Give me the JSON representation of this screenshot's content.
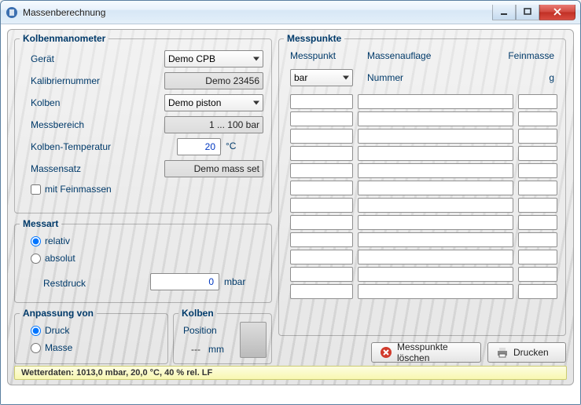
{
  "window": {
    "title": "Massenberechnung"
  },
  "kolbenmanometer": {
    "legend": "Kolbenmanometer",
    "geraet_label": "Gerät",
    "geraet_value": "Demo CPB",
    "kalibriernummer_label": "Kalibriernummer",
    "kalibriernummer_value": "Demo 23456",
    "kolben_label": "Kolben",
    "kolben_value": "Demo piston",
    "messbereich_label": "Messbereich",
    "messbereich_value": "1 ... 100 bar",
    "kolbentemp_label": "Kolben-Temperatur",
    "kolbentemp_value": "20",
    "kolbentemp_unit": "°C",
    "massensatz_label": "Massensatz",
    "massensatz_value": "Demo mass set",
    "feinmassen_label": "mit Feinmassen"
  },
  "messart": {
    "legend": "Messart",
    "relativ_label": "relativ",
    "absolut_label": "absolut",
    "restdruck_label": "Restdruck",
    "restdruck_value": "0",
    "restdruck_unit": "mbar"
  },
  "anpassung": {
    "legend": "Anpassung von",
    "druck_label": "Druck",
    "masse_label": "Masse"
  },
  "kolbenbox": {
    "legend": "Kolben",
    "position_label": "Position",
    "position_value": "---",
    "position_unit": "mm"
  },
  "messpunkte": {
    "legend": "Messpunkte",
    "col_messpunkt": "Messpunkt",
    "col_massenauflage": "Massenauflage",
    "col_feinmasse": "Feinmasse",
    "unit_select": "bar",
    "nummer_label": "Nummer",
    "feinmasse_unit": "g",
    "row_count": 12
  },
  "buttons": {
    "loeschen": "Messpunkte löschen",
    "drucken": "Drucken"
  },
  "status": "Wetterdaten: 1013,0 mbar, 20,0 °C, 40 % rel. LF"
}
